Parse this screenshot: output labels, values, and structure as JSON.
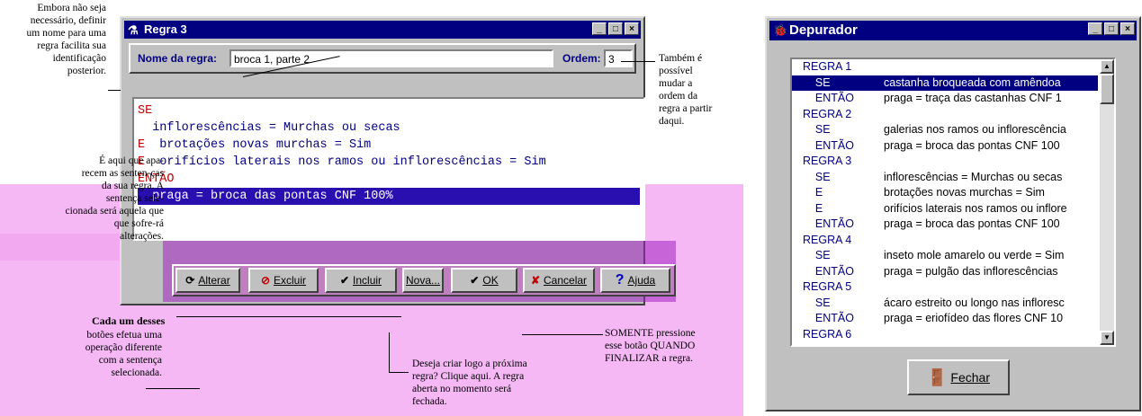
{
  "regra_window": {
    "title": "Regra 3",
    "name_label": "Nome da regra:",
    "name_value": "broca 1, parte 2",
    "order_label": "Ordem:",
    "order_value": "3",
    "rule_lines": [
      {
        "kw": "SE",
        "text": ""
      },
      {
        "kw": "",
        "text": "  inflorescências = Murchas ou secas"
      },
      {
        "kw": "E",
        "text": "  brotações novas murchas = Sim"
      },
      {
        "kw": "E",
        "text": "  orifícios laterais nos ramos ou inflorescências = Sim"
      },
      {
        "kw": "ENTÃO",
        "text": ""
      },
      {
        "kw": "",
        "text": "  praga = broca das pontas CNF 100%"
      }
    ],
    "buttons": {
      "alterar": "Alterar",
      "excluir": "Excluir",
      "incluir": "Incluir",
      "nova": "Nova...",
      "ok": "OK",
      "cancelar": "Cancelar",
      "ajuda": "Ajuda"
    },
    "title_buttons": [
      "_",
      "□",
      "×"
    ]
  },
  "depurador_window": {
    "title": "Depurador",
    "title_buttons": [
      "_",
      "□",
      "×"
    ],
    "list": [
      {
        "c1": "REGRA 1",
        "c2": ""
      },
      {
        "c1": "    SE",
        "c2": "castanha broqueada com amêndoa"
      },
      {
        "c1": "    ENTÃO",
        "c2": "praga = traça das castanhas CNF 1"
      },
      {
        "c1": "REGRA 2",
        "c2": ""
      },
      {
        "c1": "    SE",
        "c2": "galerias nos ramos ou inflorescência"
      },
      {
        "c1": "    ENTÃO",
        "c2": "praga = broca das pontas CNF 100"
      },
      {
        "c1": "REGRA 3",
        "c2": ""
      },
      {
        "c1": "    SE",
        "c2": "inflorescências = Murchas ou secas"
      },
      {
        "c1": "    E",
        "c2": "brotações novas murchas = Sim"
      },
      {
        "c1": "    E",
        "c2": "orifícios laterais nos ramos ou inflore"
      },
      {
        "c1": "    ENTÃO",
        "c2": "praga = broca das pontas CNF 100"
      },
      {
        "c1": "REGRA 4",
        "c2": ""
      },
      {
        "c1": "    SE",
        "c2": "inseto mole amarelo ou verde = Sim"
      },
      {
        "c1": "    ENTÃO",
        "c2": "praga = pulgão das inflorescências"
      },
      {
        "c1": "REGRA 5",
        "c2": ""
      },
      {
        "c1": "    SE",
        "c2": "ácaro estreito ou longo nas infloresc"
      },
      {
        "c1": "    ENTÃO",
        "c2": "praga = eriofídeo das flores CNF 10"
      },
      {
        "c1": "REGRA 6",
        "c2": ""
      }
    ],
    "close_button": "Fechar"
  },
  "annotations": {
    "a1": [
      "Embora não seja",
      "necessário, definir",
      "um nome para uma",
      "regra facilita sua",
      "identificação",
      "posterior."
    ],
    "a2": [
      "Também é",
      "possível",
      "mudar a",
      "ordem da",
      "regra a partir",
      "daqui."
    ],
    "a3": [
      "É aqui que apa-",
      "recem as senten-ças",
      "da sua regra. A",
      "sentença sele-",
      "cionada será aquela que",
      "que sofre-rá",
      "alterações."
    ],
    "a4_title": "Cada um desses",
    "a4": [
      "botões efetua uma",
      "operação diferente",
      "com a sentença",
      "selecionada."
    ],
    "a5": [
      "Deseja criar logo a próxima",
      "regra? Clique aqui. A regra",
      "aberta no momento será",
      "fechada."
    ],
    "a6": [
      "SOMENTE pressione",
      "esse botão QUANDO",
      "FINALIZAR a regra."
    ]
  }
}
